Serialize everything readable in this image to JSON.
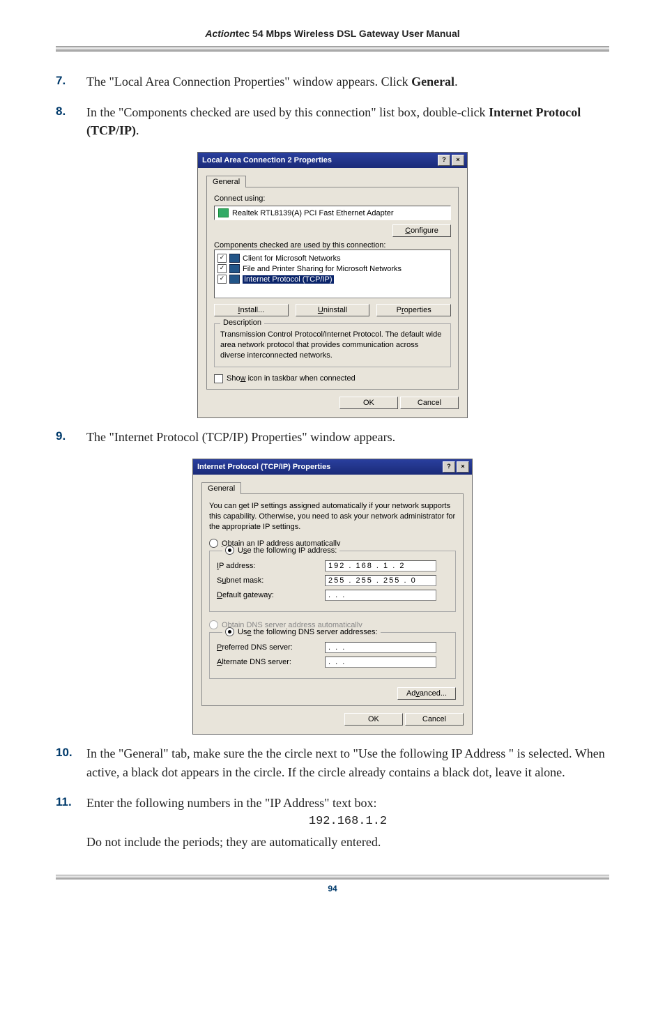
{
  "header": {
    "brand": "Action",
    "suffix": "tec 54 Mbps Wireless DSL Gateway User Manual"
  },
  "steps": {
    "s7": {
      "num": "7.",
      "text_a": "The \"Local Area Connection Properties\" window appears. Click ",
      "bold": "General",
      "text_b": "."
    },
    "s8": {
      "num": "8.",
      "text_a": "In the \"Components checked are used by this connection\" list box, double-click ",
      "bold": "Internet Protocol (TCP/IP)",
      "text_b": "."
    },
    "s9": {
      "num": "9.",
      "text_a": "The \"Internet Protocol (",
      "sc": "TCP/IP",
      "text_b": ") Properties\" window appears."
    },
    "s10": {
      "num": "10.",
      "text_a": "In the \"General\" tab, make sure the the circle next to \"Use the following ",
      "sc": "IP",
      "text_b": " Address \" is selected. When active, a black dot appears in the circle. If the circle already contains a black dot, leave it alone."
    },
    "s11": {
      "num": "11.",
      "text_a": "Enter the following numbers in the \"",
      "sc": "IP",
      "text_b": " Address\" text box:",
      "code": "192.168.1.2",
      "text_c": "Do not include the periods; they are automatically entered."
    }
  },
  "dlg1": {
    "title": "Local Area Connection 2 Properties",
    "tab": "General",
    "connect_using": "Connect using:",
    "adapter": "Realtek RTL8139(A) PCI Fast Ethernet Adapter",
    "configure": "Configure",
    "components_label": "Components checked are used by this connection:",
    "items": [
      "Client for Microsoft Networks",
      "File and Printer Sharing for Microsoft Networks",
      "Internet Protocol (TCP/IP)"
    ],
    "install": "Install...",
    "uninstall": "Uninstall",
    "properties": "Properties",
    "desc_title": "Description",
    "desc_text": "Transmission Control Protocol/Internet Protocol. The default wide area network protocol that provides communication across diverse interconnected networks.",
    "show_icon": "Show icon in taskbar when connected",
    "ok": "OK",
    "cancel": "Cancel",
    "help": "?",
    "close": "×"
  },
  "dlg2": {
    "title": "Internet Protocol (TCP/IP) Properties",
    "tab": "General",
    "blurb": "You can get IP settings assigned automatically if your network supports this capability. Otherwise, you need to ask your network administrator for the appropriate IP settings.",
    "obtain_ip": "Obtain an IP address automatically",
    "use_ip": "Use the following IP address:",
    "ip_label": "IP address:",
    "ip_value": "192 . 168 .  1  .  2",
    "subnet_label": "Subnet mask:",
    "subnet_value": "255 . 255 . 255 .  0",
    "gateway_label": "Default gateway:",
    "gateway_value": " .      .      .",
    "obtain_dns": "Obtain DNS server address automatically",
    "use_dns": "Use the following DNS server addresses:",
    "pref_dns": "Preferred DNS server:",
    "alt_dns": "Alternate DNS server:",
    "dns_blank": " .      .      .",
    "advanced": "Advanced...",
    "ok": "OK",
    "cancel": "Cancel",
    "help": "?",
    "close": "×"
  },
  "footer": {
    "page": "94"
  }
}
